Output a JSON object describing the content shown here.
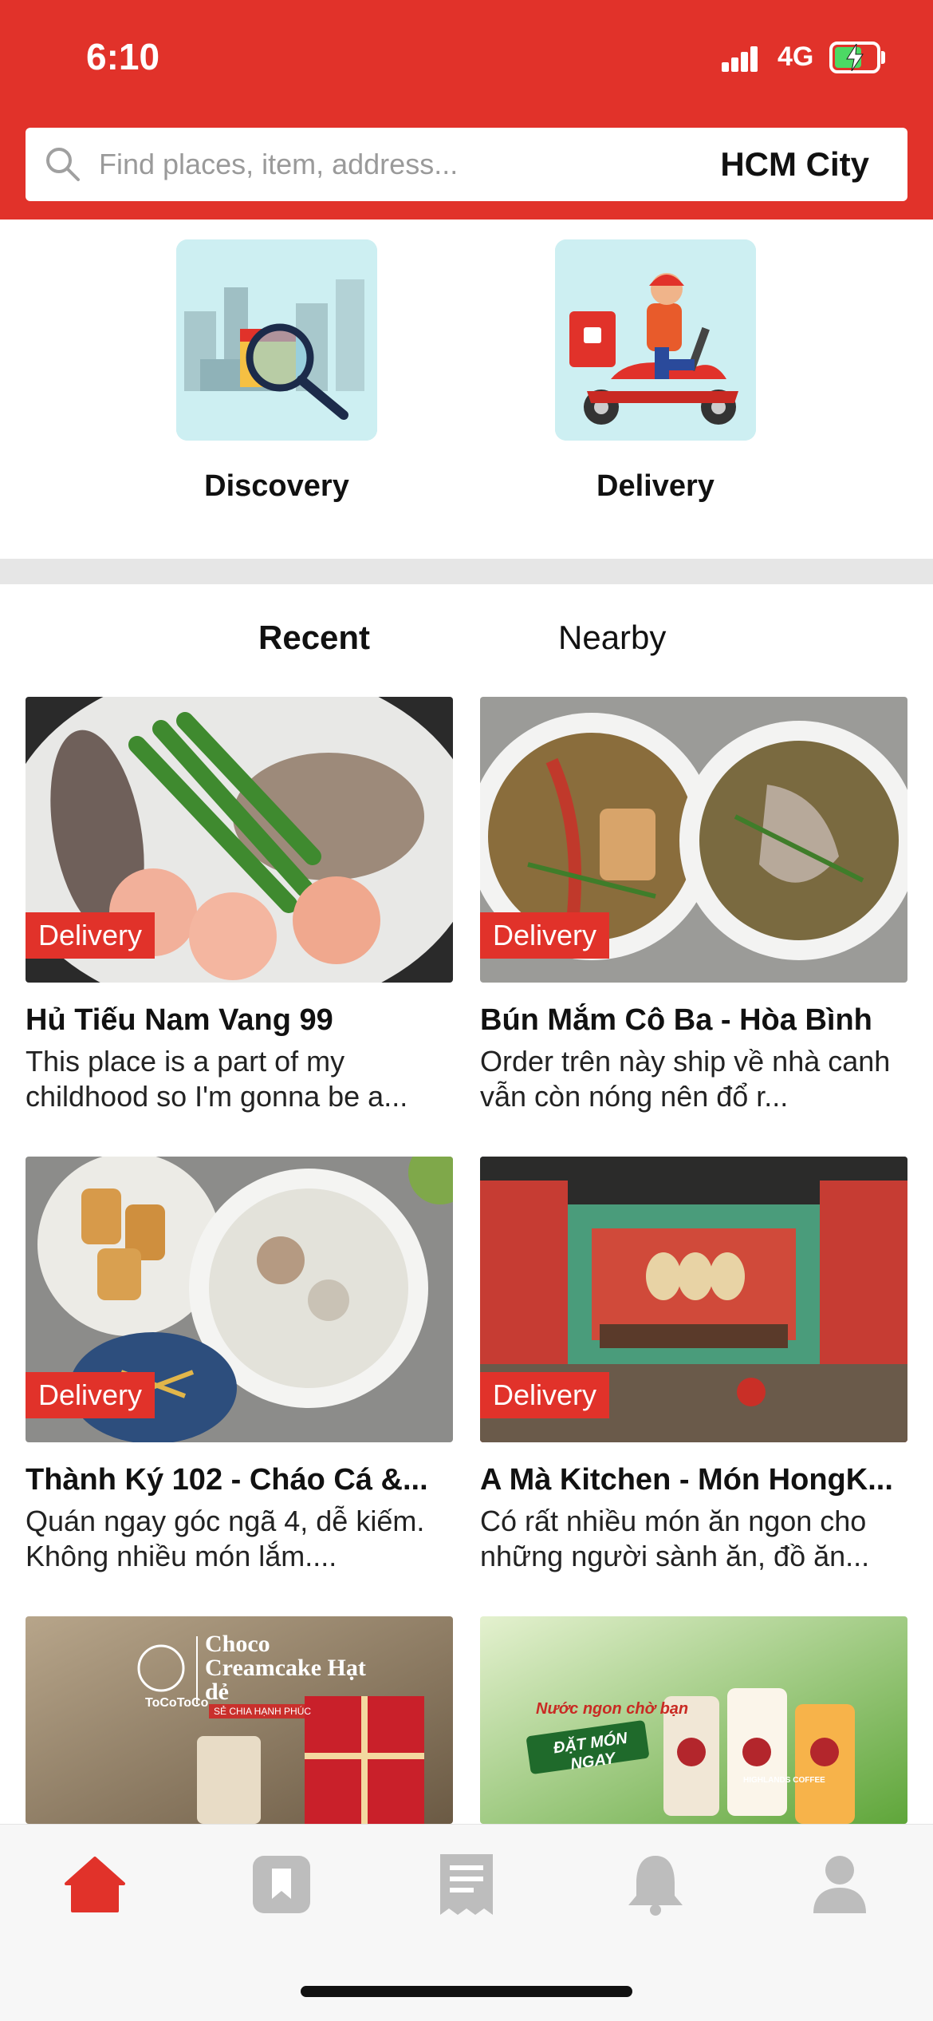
{
  "status_bar": {
    "time": "6:10",
    "network": "4G"
  },
  "search": {
    "placeholder": "Find places, item, address...",
    "city": "HCM City"
  },
  "quick_actions": [
    {
      "label": "Discovery",
      "icon": "city-magnifier-illustration"
    },
    {
      "label": "Delivery",
      "icon": "scooter-delivery-illustration"
    }
  ],
  "tabs": [
    {
      "label": "Recent",
      "active": true
    },
    {
      "label": "Nearby",
      "active": false
    }
  ],
  "cards": [
    {
      "badge": "Delivery",
      "title": "Hủ Tiếu Nam Vang 99",
      "description": "This place is a part of my childhood so I'm gonna be a..."
    },
    {
      "badge": "Delivery",
      "title": "Bún Mắm Cô Ba - Hòa Bình",
      "description": "Order trên này ship về nhà canh vẫn còn nóng nên đổ r..."
    },
    {
      "badge": "Delivery",
      "title": "Thành Ký 102 - Cháo Cá &...",
      "description": "Quán ngay góc ngã 4, dễ kiếm. Không nhiều món lắm...."
    },
    {
      "badge": "Delivery",
      "title": "A Mà Kitchen - Món HongK...",
      "description": "Có rất nhiều món ăn ngon cho những người sành ăn, đồ ăn..."
    }
  ],
  "promos": [
    {
      "brand": "ToCoToCo",
      "headline": "Choco Creamcake Hạt dẻ",
      "tagline": "SẺ CHIA HẠNH PHÚC"
    },
    {
      "brand": "HIGHLANDS COFFEE",
      "headline": "Nước ngon chờ bạn",
      "cta": "ĐẶT MÓN NGAY"
    }
  ],
  "bottom_nav": [
    {
      "icon": "home-icon",
      "active": true
    },
    {
      "icon": "bookmark-icon",
      "active": false
    },
    {
      "icon": "receipt-icon",
      "active": false
    },
    {
      "icon": "bell-icon",
      "active": false
    },
    {
      "icon": "profile-icon",
      "active": false
    }
  ],
  "colors": {
    "brand_red": "#e1322a",
    "inactive_icon": "#bdbdbd",
    "tile_bg": "#cdeff2"
  }
}
